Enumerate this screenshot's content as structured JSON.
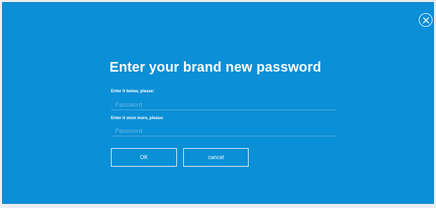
{
  "dialog": {
    "title": "Enter your brand new password",
    "fields": [
      {
        "label": "Enter it below, please:",
        "placeholder": "Password",
        "value": ""
      },
      {
        "label": "Enter it once more, please:",
        "placeholder": "Password",
        "value": ""
      }
    ],
    "buttons": {
      "ok": "OK",
      "cancel": "cancel"
    },
    "close_icon": "close-icon"
  },
  "colors": {
    "panel_background": "#0b8fd6",
    "text": "#ffffff"
  }
}
